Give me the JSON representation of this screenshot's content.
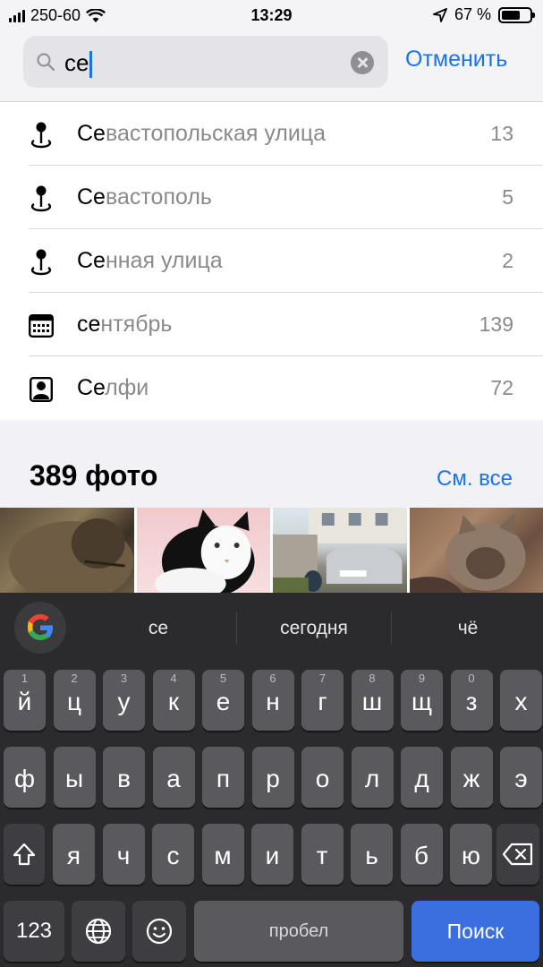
{
  "status_bar": {
    "carrier": "250-60",
    "time": "13:29",
    "battery": "67 %",
    "battery_level": 0.67
  },
  "search": {
    "query": "се",
    "cancel_label": "Отменить"
  },
  "results": [
    {
      "icon": "location-pin-icon",
      "highlight": "Се",
      "rest": "вастопольская улица",
      "count": "13"
    },
    {
      "icon": "location-pin-icon",
      "highlight": "Се",
      "rest": "вастополь",
      "count": "5"
    },
    {
      "icon": "location-pin-icon",
      "highlight": "Се",
      "rest": "нная улица",
      "count": "2"
    },
    {
      "icon": "calendar-icon",
      "highlight": "се",
      "rest": "нтябрь",
      "count": "139"
    },
    {
      "icon": "person-icon",
      "highlight": "Се",
      "rest": "лфи",
      "count": "72"
    }
  ],
  "photos": {
    "title": "389 фото",
    "see_all": "См. все"
  },
  "keyboard": {
    "suggestions": [
      "се",
      "сегодня",
      "чё"
    ],
    "row1": [
      {
        "ch": "й",
        "num": "1"
      },
      {
        "ch": "ц",
        "num": "2"
      },
      {
        "ch": "у",
        "num": "3"
      },
      {
        "ch": "к",
        "num": "4"
      },
      {
        "ch": "е",
        "num": "5"
      },
      {
        "ch": "н",
        "num": "6"
      },
      {
        "ch": "г",
        "num": "7"
      },
      {
        "ch": "ш",
        "num": "8"
      },
      {
        "ch": "щ",
        "num": "9"
      },
      {
        "ch": "з",
        "num": "0"
      },
      {
        "ch": "х",
        "num": ""
      }
    ],
    "row2": [
      "ф",
      "ы",
      "в",
      "а",
      "п",
      "р",
      "о",
      "л",
      "д",
      "ж",
      "э"
    ],
    "row3": [
      "я",
      "ч",
      "с",
      "м",
      "и",
      "т",
      "ь",
      "б",
      "ю"
    ],
    "numbers_key": "123",
    "space_label": "пробел",
    "search_key": "Поиск"
  }
}
